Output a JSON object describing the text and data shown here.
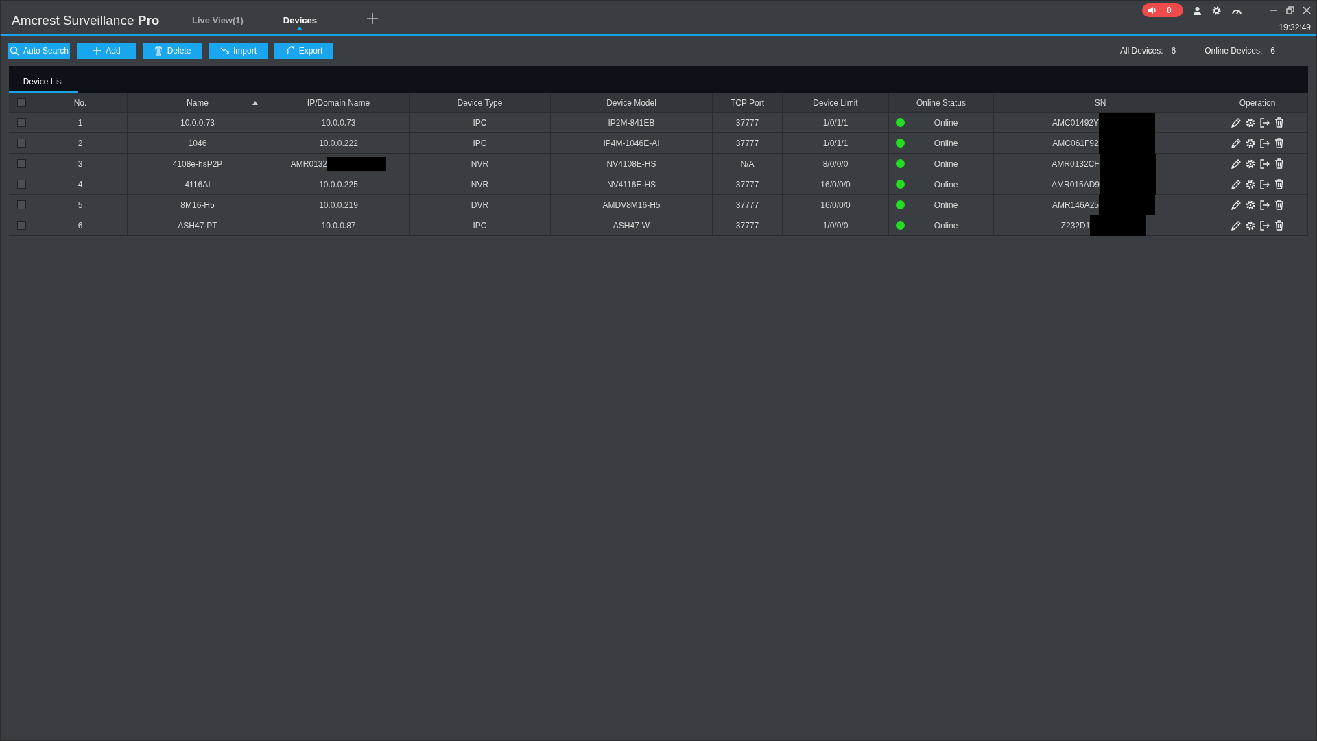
{
  "app": {
    "title": "Amcrest Surveillance **Pro**",
    "clock": "19:32:49",
    "alarm_count": "0"
  },
  "tabs": [
    {
      "label": "Live View(1)",
      "selected": false
    },
    {
      "label": "Devices",
      "selected": true
    }
  ],
  "toolbar": [
    {
      "label": "Auto Search"
    },
    {
      "label": "Add"
    },
    {
      "label": "Delete"
    },
    {
      "label": "Import"
    },
    {
      "label": "Export"
    }
  ],
  "counts": [
    {
      "label": "All Devices:",
      "value": "6"
    },
    {
      "label": "Online Devices:",
      "value": "6"
    }
  ],
  "panel_tabs": [
    {
      "label": "Device List",
      "selected": true
    }
  ],
  "table": {
    "header_checked": false,
    "columns": [
      {
        "label": "No.",
        "sorted": false
      },
      {
        "label": "Name",
        "sorted": true
      },
      {
        "label": "IP/Domain Name",
        "sorted": false
      },
      {
        "label": "Device Type",
        "sorted": false
      },
      {
        "label": "Device Model",
        "sorted": false
      },
      {
        "label": "TCP Port",
        "sorted": false
      },
      {
        "label": "Device Limit",
        "sorted": false
      },
      {
        "label": "Online Status",
        "sorted": false
      },
      {
        "label": "SN",
        "sorted": false
      },
      {
        "label": "Operation",
        "sorted": false
      }
    ],
    "rows": [
      {
        "checked": false,
        "no": "1",
        "name": "10.0.0.73",
        "ip": "10.0.0.73",
        "redact_ip": false,
        "type": "IPC",
        "model": "IP2M-841EB",
        "port": "37777",
        "limit": "1/0/1/1",
        "online": true,
        "status": "Online",
        "sn": "AMC01492Y",
        "redact_sn": true
      },
      {
        "checked": false,
        "no": "2",
        "name": "1046",
        "ip": "10.0.0.222",
        "redact_ip": false,
        "type": "IPC",
        "model": "IP4M-1046E-AI",
        "port": "37777",
        "limit": "1/0/1/1",
        "online": true,
        "status": "Online",
        "sn": "AMC061F92",
        "redact_sn": true
      },
      {
        "checked": false,
        "no": "3",
        "name": "4108e-hsP2P",
        "ip": "AMR0132",
        "redact_ip": true,
        "type": "NVR",
        "model": "NV4108E-HS",
        "port": "N/A",
        "limit": "8/0/0/0",
        "online": true,
        "status": "Online",
        "sn": "AMR0132CF",
        "redact_sn": true
      },
      {
        "checked": false,
        "no": "4",
        "name": "4116AI",
        "ip": "10.0.0.225",
        "redact_ip": false,
        "type": "NVR",
        "model": "NV4116E-HS",
        "port": "37777",
        "limit": "16/0/0/0",
        "online": true,
        "status": "Online",
        "sn": "AMR015AD9",
        "redact_sn": true
      },
      {
        "checked": false,
        "no": "5",
        "name": "8M16-H5",
        "ip": "10.0.0.219",
        "redact_ip": false,
        "type": "DVR",
        "model": "AMDV8M16-H5",
        "port": "37777",
        "limit": "16/0/0/0",
        "online": true,
        "status": "Online",
        "sn": "AMR146A25",
        "redact_sn": true
      },
      {
        "checked": false,
        "no": "6",
        "name": "ASH47-PT",
        "ip": "10.0.0.87",
        "redact_ip": false,
        "type": "IPC",
        "model": "ASH47-W",
        "port": "37777",
        "limit": "1/0/0/0",
        "online": true,
        "status": "Online",
        "sn": "Z232D1",
        "redact_sn": true
      }
    ]
  }
}
